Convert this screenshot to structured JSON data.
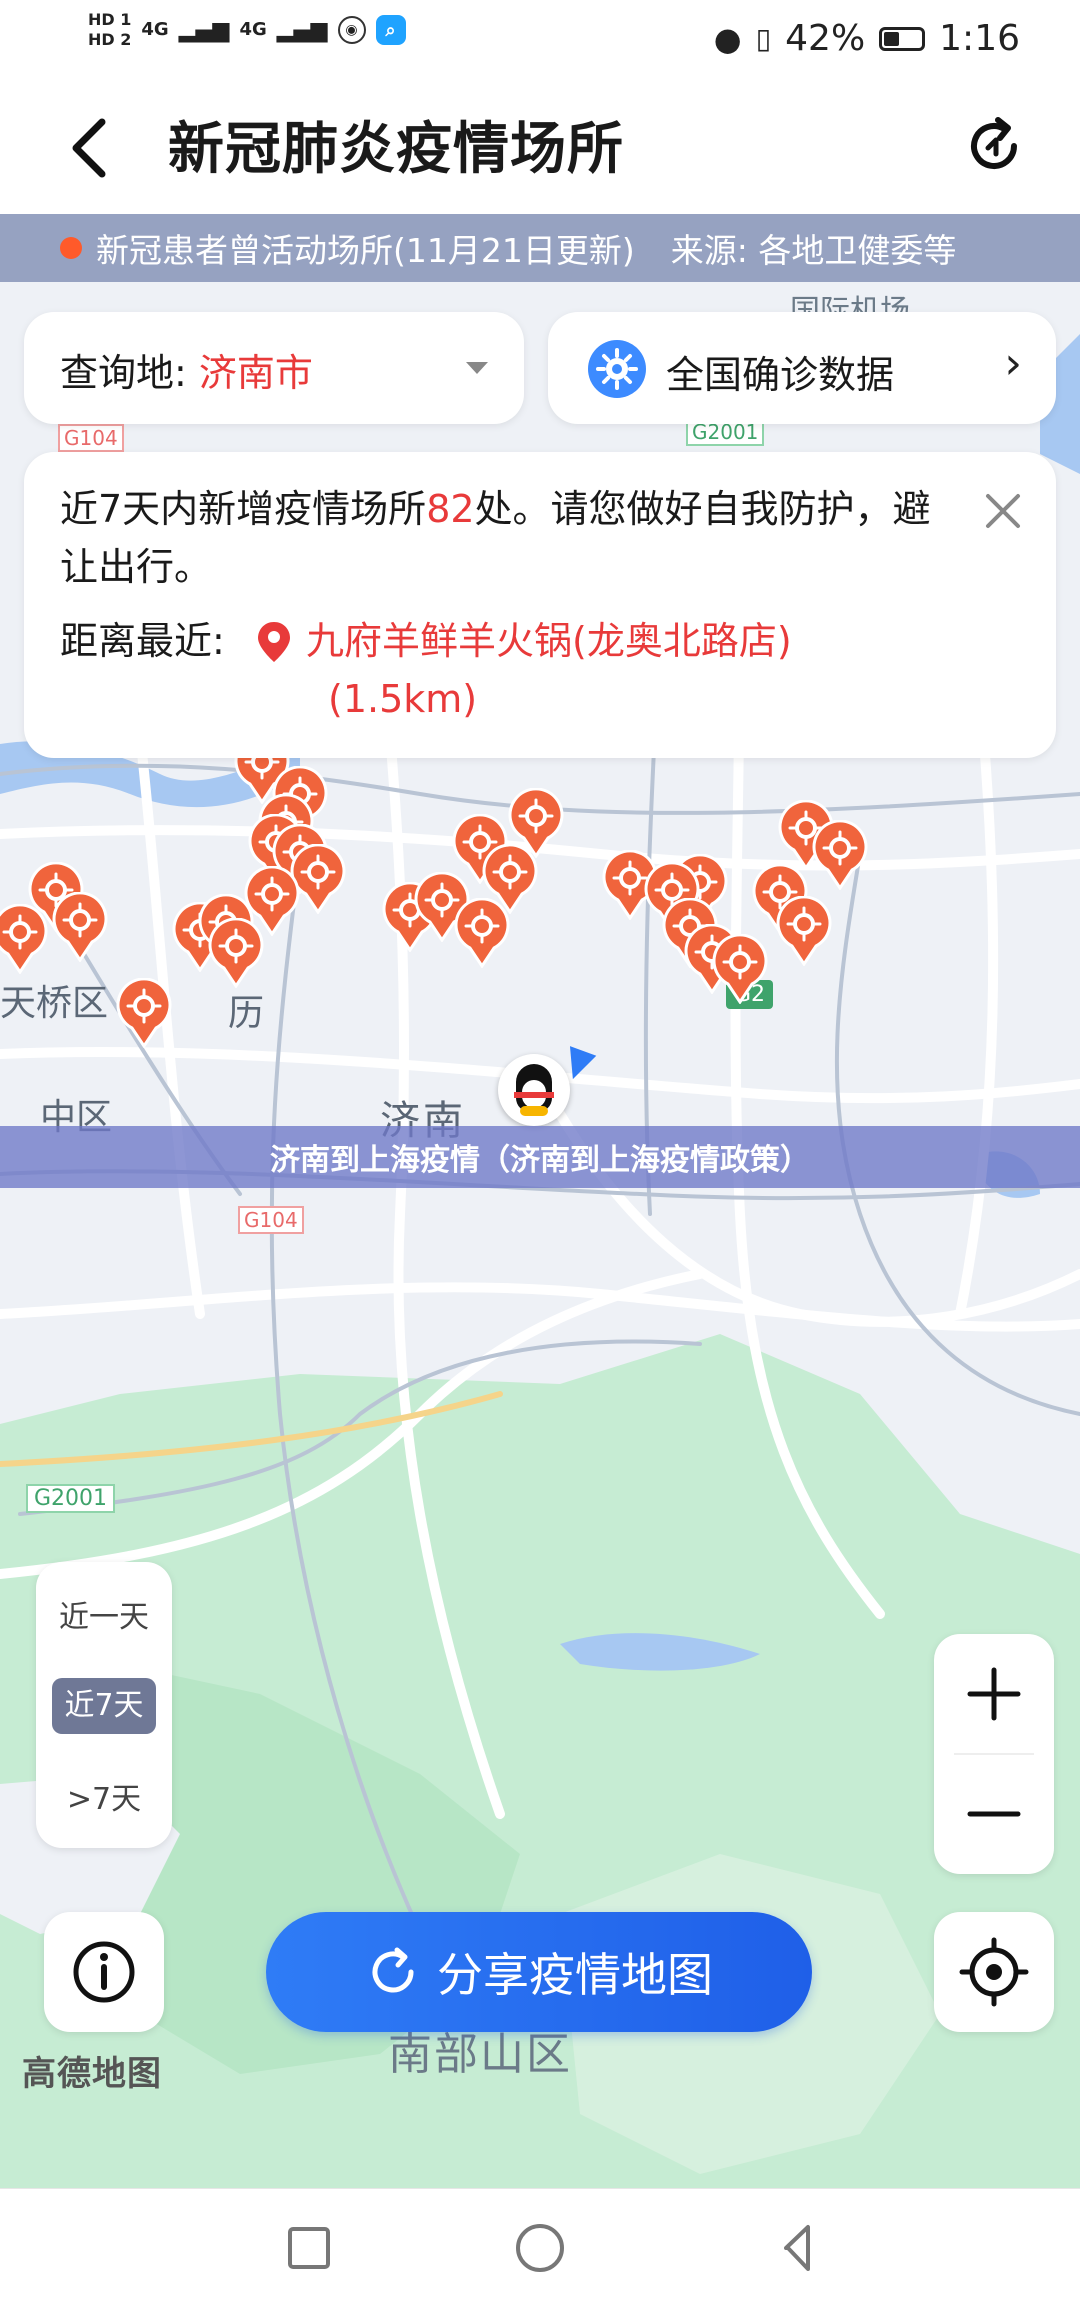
{
  "status_bar": {
    "hd1": "HD 1",
    "hd2": "HD 2",
    "net1": "4G",
    "net2": "4G",
    "battery_percent": "42%",
    "battery_level": 0.42,
    "time": "1:16"
  },
  "header": {
    "title": "新冠肺炎疫情场所"
  },
  "strip": {
    "update": "新冠患者曾活动场所(11月21日更新)",
    "source": "来源: 各地卫健委等"
  },
  "query": {
    "label": "查询地: ",
    "city": "济南市"
  },
  "national": {
    "label": "全国确诊数据"
  },
  "notice": {
    "text_before": "近7天内新增疫情场所",
    "count": "82",
    "text_after": "处。请您做好自我防护，避让出行。",
    "nearest_label": "距离最近:",
    "nearest_place": "九府羊鲜羊火锅(龙奥北路店)",
    "nearest_distance": "(1.5km)"
  },
  "banner": {
    "text": "济南到上海疫情（济南到上海疫情政策）"
  },
  "time_filter": {
    "items": [
      "近一天",
      "近7天",
      ">7天"
    ],
    "selected": "近7天"
  },
  "map_labels": {
    "district_tianqiao": "天桥区",
    "district_huaiyin": "中区",
    "district_li": "历",
    "city_jinan": "济南",
    "airport": "国际机场",
    "south_mountain": "南部山区",
    "road_g104_top": "G104",
    "road_g104_bottom": "G104",
    "road_g2001_top": "G2001",
    "road_g2001_left": "G2001",
    "road_g2": "G2"
  },
  "share": {
    "label": "分享疫情地图"
  },
  "map_provider": "高德地图",
  "colors": {
    "accent_red": "#e83a3a",
    "marker_orange": "#f0643c",
    "primary_blue": "#2f7cf6"
  }
}
